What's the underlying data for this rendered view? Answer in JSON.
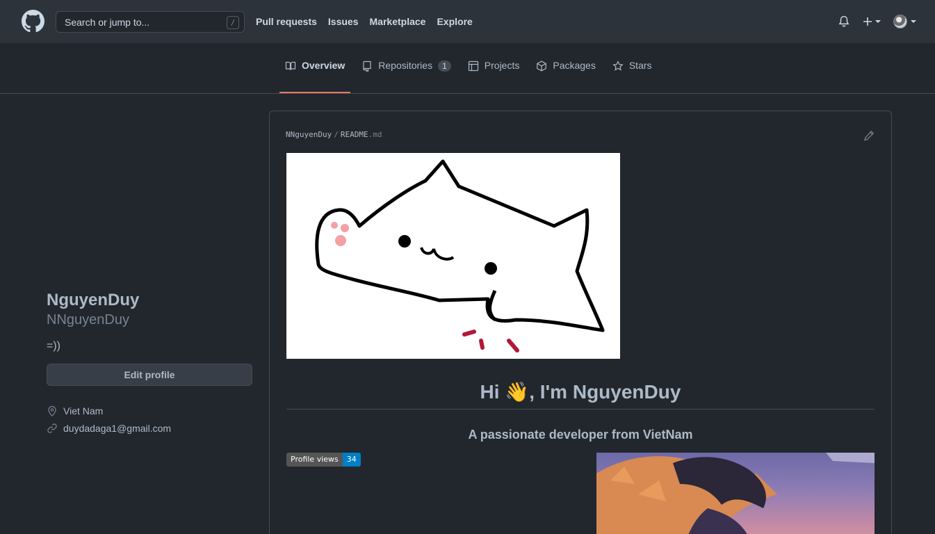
{
  "header": {
    "search_placeholder": "Search or jump to...",
    "search_shortcut": "/",
    "nav": [
      "Pull requests",
      "Issues",
      "Marketplace",
      "Explore"
    ]
  },
  "tabs": [
    {
      "label": "Overview",
      "icon": "book-icon",
      "active": true
    },
    {
      "label": "Repositories",
      "icon": "repo-icon",
      "count": "1"
    },
    {
      "label": "Projects",
      "icon": "table-icon"
    },
    {
      "label": "Packages",
      "icon": "package-icon"
    },
    {
      "label": "Stars",
      "icon": "star-icon"
    }
  ],
  "profile": {
    "name": "NguyenDuy",
    "username": "NNguyenDuy",
    "bio": "=))",
    "edit_label": "Edit profile",
    "location": "Viet Nam",
    "email": "duydadaga1@gmail.com"
  },
  "readme": {
    "owner": "NNguyenDuy",
    "file": "README",
    "ext": ".md",
    "heading": "Hi 👋, I'm NguyenDuy",
    "tagline": "A passionate developer from VietNam",
    "badge_label": "Profile views",
    "badge_value": "34"
  },
  "colors": {
    "background": "#22272e",
    "header": "#2d333b",
    "accent_tab": "#ec775c",
    "badge_blue": "#007ec6"
  }
}
